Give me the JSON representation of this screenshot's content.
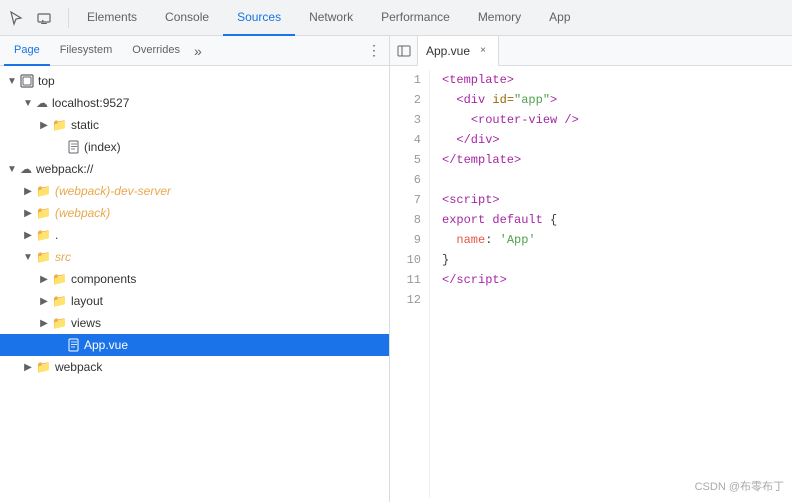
{
  "toolbar": {
    "icons": [
      {
        "name": "cursor-icon",
        "symbol": "⬡"
      },
      {
        "name": "device-icon",
        "symbol": "▭"
      }
    ],
    "tabs": [
      {
        "id": "elements",
        "label": "Elements",
        "active": false
      },
      {
        "id": "console",
        "label": "Console",
        "active": false
      },
      {
        "id": "sources",
        "label": "Sources",
        "active": true
      },
      {
        "id": "network",
        "label": "Network",
        "active": false
      },
      {
        "id": "performance",
        "label": "Performance",
        "active": false
      },
      {
        "id": "memory",
        "label": "Memory",
        "active": false
      },
      {
        "id": "app",
        "label": "App",
        "active": false
      }
    ]
  },
  "left_panel": {
    "sub_tabs": [
      {
        "id": "page",
        "label": "Page",
        "active": true
      },
      {
        "id": "filesystem",
        "label": "Filesystem",
        "active": false
      },
      {
        "id": "overrides",
        "label": "Overrides",
        "active": false
      }
    ],
    "tree": [
      {
        "id": "top",
        "label": "top",
        "indent": 0,
        "type": "expand-folder",
        "expanded": true,
        "icon": "box"
      },
      {
        "id": "localhost",
        "label": "localhost:9527",
        "indent": 1,
        "type": "expand-cloud",
        "expanded": true,
        "icon": "cloud"
      },
      {
        "id": "static",
        "label": "static",
        "indent": 2,
        "type": "expand-folder",
        "expanded": false,
        "icon": "folder-orange"
      },
      {
        "id": "index",
        "label": "(index)",
        "indent": 2,
        "type": "file",
        "icon": "file"
      },
      {
        "id": "webpack",
        "label": "webpack://",
        "indent": 0,
        "type": "expand-cloud",
        "expanded": true,
        "icon": "cloud"
      },
      {
        "id": "webpack-dev-server",
        "label": "(webpack)-dev-server",
        "indent": 1,
        "type": "expand-folder-orange",
        "expanded": false,
        "icon": "folder-orange",
        "italic": true
      },
      {
        "id": "webpack2",
        "label": "(webpack)",
        "indent": 1,
        "type": "expand-folder-orange",
        "expanded": false,
        "icon": "folder-orange",
        "italic": true
      },
      {
        "id": "dot",
        "label": ".",
        "indent": 1,
        "type": "expand-folder-orange",
        "expanded": false,
        "icon": "folder-orange"
      },
      {
        "id": "src",
        "label": "src",
        "indent": 1,
        "type": "expand-folder-orange",
        "expanded": true,
        "icon": "folder-orange",
        "italic": true
      },
      {
        "id": "components",
        "label": "components",
        "indent": 2,
        "type": "expand-folder-orange",
        "expanded": false,
        "icon": "folder-orange",
        "italic": false
      },
      {
        "id": "layout",
        "label": "layout",
        "indent": 2,
        "type": "expand-folder-orange",
        "expanded": false,
        "icon": "folder-orange",
        "italic": false
      },
      {
        "id": "views",
        "label": "views",
        "indent": 2,
        "type": "expand-folder-orange",
        "expanded": false,
        "icon": "folder-orange",
        "italic": false
      },
      {
        "id": "appvue",
        "label": "App.vue",
        "indent": 3,
        "type": "file-selected",
        "icon": "file"
      },
      {
        "id": "webpack3",
        "label": "webpack",
        "indent": 1,
        "type": "expand-folder-orange",
        "expanded": false,
        "icon": "folder-orange"
      }
    ]
  },
  "editor": {
    "tab_label": "App.vue",
    "nav_icon": "◁",
    "lines": [
      {
        "num": 1,
        "html": "<span class='kw'>&lt;template&gt;</span>"
      },
      {
        "num": 2,
        "html": "  <span class='kw'>&lt;div</span> <span class='attr'>id=</span><span class='str'>\"app\"</span><span class='kw'>&gt;</span>"
      },
      {
        "num": 3,
        "html": "    <span class='kw'>&lt;router-view /&gt;</span>"
      },
      {
        "num": 4,
        "html": "  <span class='kw'>&lt;/div&gt;</span>"
      },
      {
        "num": 5,
        "html": "<span class='kw'>&lt;/template&gt;</span>"
      },
      {
        "num": 6,
        "html": ""
      },
      {
        "num": 7,
        "html": "<span class='kw'>&lt;script&gt;</span>"
      },
      {
        "num": 8,
        "html": "<span class='export-kw'>export</span> <span class='js-kw'>default</span> <span class='bracket'>{</span>"
      },
      {
        "num": 9,
        "html": "  <span class='prop'>name</span><span class='plain'>: </span><span class='str'>'App'</span>"
      },
      {
        "num": 10,
        "html": "<span class='bracket'>}</span>"
      },
      {
        "num": 11,
        "html": "<span class='kw'>&lt;/script&gt;</span>"
      },
      {
        "num": 12,
        "html": ""
      }
    ]
  },
  "watermark": "CSDN @布零布丁"
}
